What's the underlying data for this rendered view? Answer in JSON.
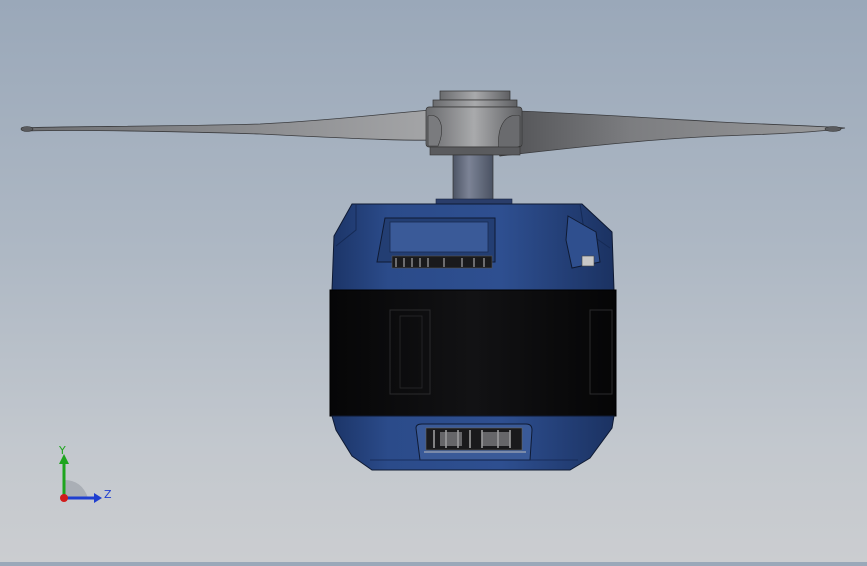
{
  "view": {
    "type": "3d-cad-viewport",
    "model": "motor-with-propeller",
    "background_top": "#9aa8b9",
    "background_bottom": "#cbcdd0"
  },
  "colors": {
    "motor_housing": "#2a4a86",
    "motor_band": "#0e0e0f",
    "propeller": "#8e8f92",
    "shaft": "#6c7384",
    "axis_y": "#1ea51e",
    "axis_z": "#1f3fd0",
    "axis_x": "#d11c1c"
  },
  "triad": {
    "y_label": "Y",
    "z_label": "Z"
  }
}
